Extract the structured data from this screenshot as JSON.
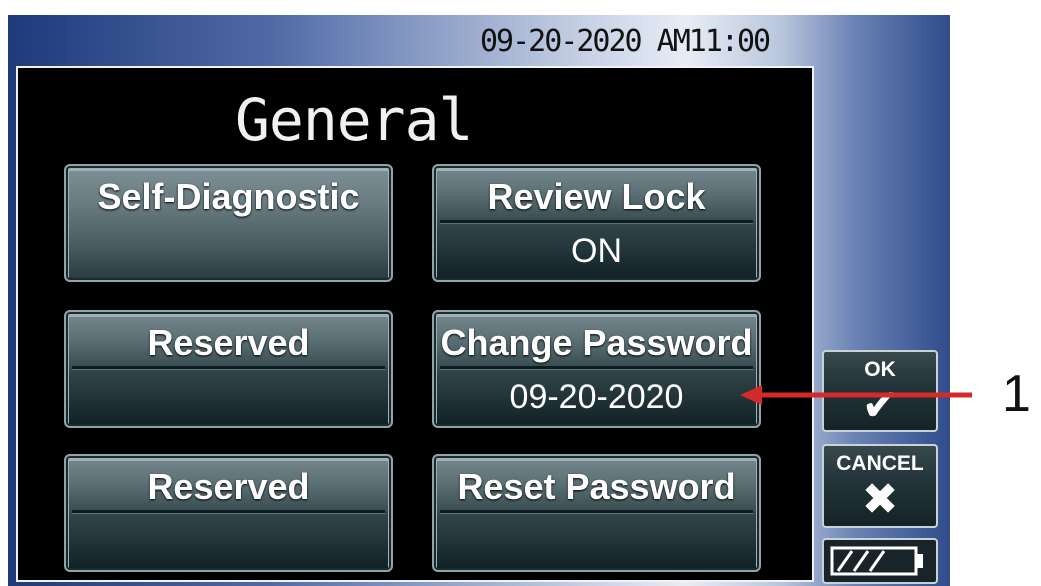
{
  "status": {
    "datetime": "09-20-2020 AM11:00"
  },
  "page": {
    "title": "General"
  },
  "tiles": {
    "self_diagnostic": {
      "label": "Self-Diagnostic",
      "value": ""
    },
    "review_lock": {
      "label": "Review Lock",
      "value": "ON"
    },
    "reserved_1": {
      "label": "Reserved",
      "value": ""
    },
    "change_password": {
      "label": "Change Password",
      "value": "09-20-2020"
    },
    "reserved_2": {
      "label": "Reserved",
      "value": ""
    },
    "reset_password": {
      "label": "Reset Password",
      "value": ""
    }
  },
  "side_buttons": {
    "ok": {
      "label": "OK",
      "icon": "check-icon"
    },
    "cancel": {
      "label": "CANCEL",
      "icon": "close-icon"
    },
    "battery": {
      "icon": "battery-icon",
      "level": 0.75
    }
  },
  "callout": {
    "number": "1",
    "arrow_color": "#d42a2a"
  }
}
